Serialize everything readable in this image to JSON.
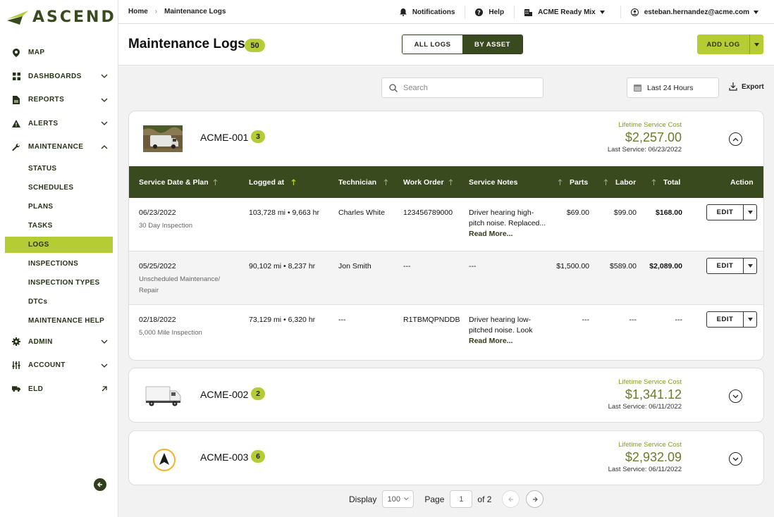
{
  "brand": {
    "name": "ASCEND"
  },
  "sidebar": {
    "items": [
      {
        "label": "MAP",
        "icon": "map-pin-icon"
      },
      {
        "label": "DASHBOARDS",
        "icon": "grid-icon"
      },
      {
        "label": "REPORTS",
        "icon": "document-icon"
      },
      {
        "label": "ALERTS",
        "icon": "alert-triangle-icon"
      },
      {
        "label": "MAINTENANCE",
        "icon": "wrench-icon"
      }
    ],
    "maintenance_sub": [
      "STATUS",
      "SCHEDULES",
      "PLANS",
      "TASKS",
      "LOGS",
      "INSPECTIONS",
      "INSPECTION TYPES",
      "DTCs",
      "MAINTENANCE HELP"
    ],
    "active_sub": "LOGS",
    "bottom_items": [
      {
        "label": "ADMIN",
        "icon": "gear-icon"
      },
      {
        "label": "ACCOUNT",
        "icon": "sliders-icon"
      },
      {
        "label": "ELD",
        "icon": "truck-icon"
      }
    ]
  },
  "topbar": {
    "breadcrumb": [
      "Home",
      "Maintenance Logs"
    ],
    "notifications": "Notifications",
    "help": "Help",
    "company": "ACME Ready Mix",
    "user": "esteban.hernandez@acme.com"
  },
  "header": {
    "title": "Maintenance Logs",
    "count": "50",
    "view_all": "ALL LOGS",
    "view_asset": "BY ASSET",
    "add_label": "ADD LOG"
  },
  "toolbar": {
    "search_placeholder": "Search",
    "date_range": "Last 24 Hours",
    "export": "Export"
  },
  "table_headers": {
    "date": "Service Date & Plan",
    "logged": "Logged at",
    "tech": "Technician",
    "wo": "Work Order",
    "notes": "Service Notes",
    "parts": "Parts",
    "labor": "Labor",
    "total": "Total",
    "action": "Action"
  },
  "edit_label": "EDIT",
  "read_more": "Read More...",
  "assets": [
    {
      "name": "ACME-001",
      "count": "3",
      "cost_label": "Lifetime Service Cost",
      "cost": "$2,257.00",
      "last_service": "Last Service: 06/23/2022",
      "rows": [
        {
          "date": "06/23/2022",
          "plan": "30 Day Inspection",
          "logged": "103,728 mi • 9,663 hr",
          "tech": "Charles White",
          "wo": "123456789000",
          "notes_1": "Driver hearing high-",
          "notes_2": "pitch noise. Replaced...",
          "parts": "$69.00",
          "labor": "$99.00",
          "total": "$168.00"
        },
        {
          "date": "05/25/2022",
          "plan_1": "Unscheduled Maintenance/",
          "plan_2": "Repair",
          "logged": "90,102 mi • 8,237 hr",
          "tech": "Jon Smith",
          "wo": "---",
          "notes": "---",
          "parts": "$1,500.00",
          "labor": "$589.00",
          "total": "$2,089.00"
        },
        {
          "date": "02/18/2022",
          "plan": "5,000 Mile Inspection",
          "logged": "73,129 mi • 6,320 hr",
          "tech": "---",
          "wo": "R1TBMQPNDDB",
          "notes_1": "Driver hearing low-",
          "notes_2": "pitched noise. Look",
          "parts": "---",
          "labor": "---",
          "total": "---"
        }
      ]
    },
    {
      "name": "ACME-002",
      "count": "2",
      "cost_label": "Lifetime Service Cost",
      "cost": "$1,341.12",
      "last_service": "Last Service: 06/11/2022"
    },
    {
      "name": "ACME-003",
      "count": "6",
      "cost_label": "Lifetime Service Cost",
      "cost": "$2,932.09",
      "last_service": "Last Service: 06/11/2022"
    }
  ],
  "pagination": {
    "display_label": "Display",
    "display_value": "100",
    "page_label": "Page",
    "page_value": "1",
    "of_label": "of 2"
  },
  "colors": {
    "accent": "#b6cc34",
    "dark": "#3a4a1f",
    "cost_green": "#6a7b2a"
  }
}
